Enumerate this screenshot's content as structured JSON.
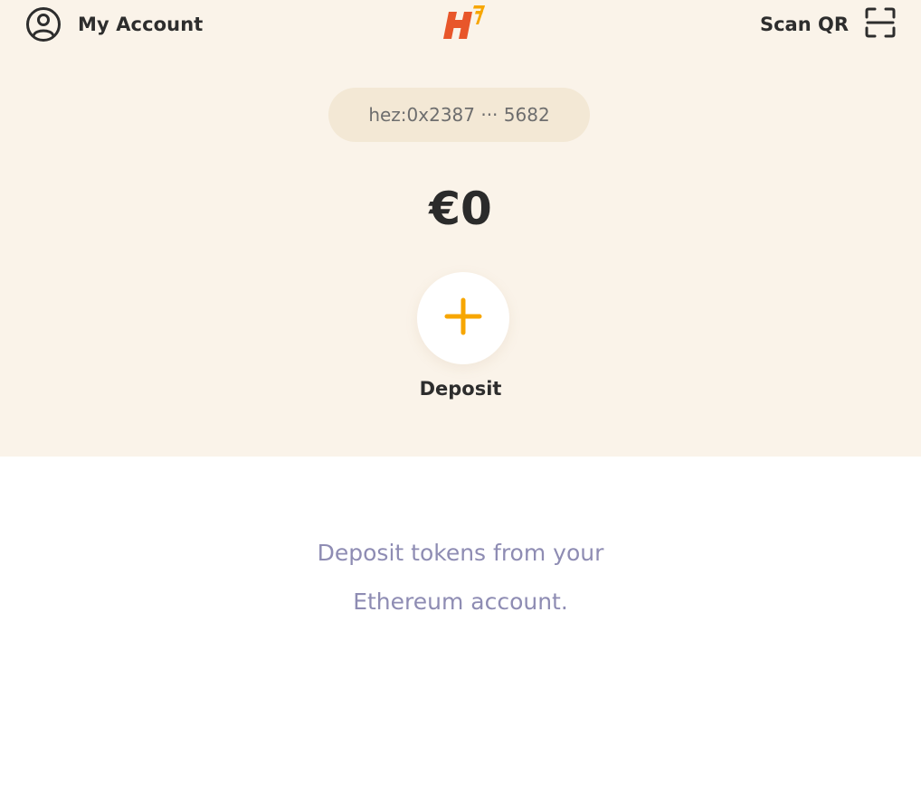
{
  "header": {
    "account_label": "My Account",
    "scan_label": "Scan QR",
    "account_icon": "user-circle-icon",
    "scan_icon": "scan-qr-icon",
    "logo": "hermez-logo"
  },
  "wallet": {
    "address": "hez:0x2387 ··· 5682",
    "balance": "€0"
  },
  "actions": {
    "deposit_label": "Deposit",
    "deposit_icon": "plus-icon"
  },
  "empty_state": {
    "line1": "Deposit tokens from your",
    "line2": "Ethereum account."
  },
  "colors": {
    "panel_bg": "#faf3e9",
    "pill_bg": "#f3e8d5",
    "accent": "#f7a600",
    "logo_orange": "#e8562a",
    "logo_yellow": "#f7a600",
    "muted_text": "#8e8cb3"
  }
}
